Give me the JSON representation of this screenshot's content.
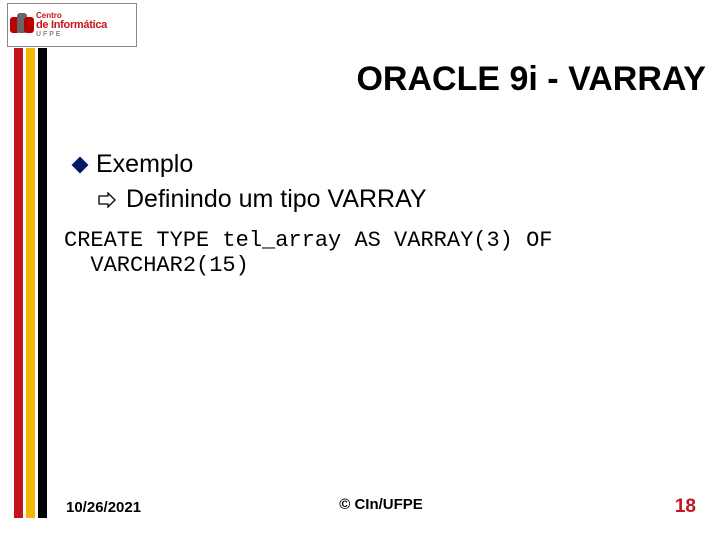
{
  "logo": {
    "line1": "Centro",
    "line2": "de Informática",
    "line3": "U F P E"
  },
  "title": {
    "shadowed": "ORACLE 9i  - ",
    "plain": "VARRAY"
  },
  "bullets": {
    "level1": "Exemplo",
    "level2": "Definindo um tipo VARRAY"
  },
  "code": "CREATE TYPE tel_array AS VARRAY(3) OF\n  VARCHAR2(15)",
  "footer": {
    "date": "10/26/2021",
    "copyright": "© CIn/UFPE",
    "page": "18"
  }
}
